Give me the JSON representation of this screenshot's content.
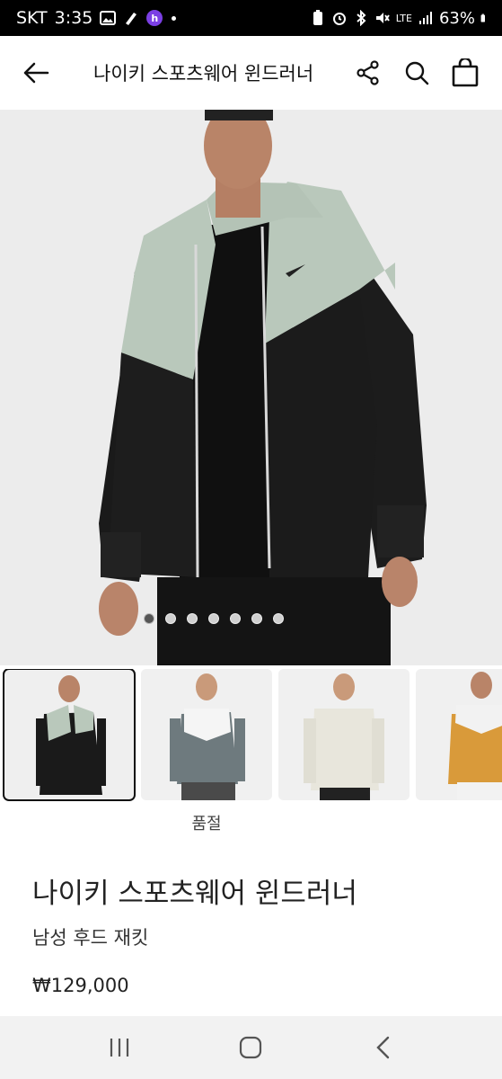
{
  "status_bar": {
    "carrier": "SKT",
    "time": "3:35",
    "network": "LTE",
    "battery": "63%"
  },
  "header": {
    "title": "나이키 스포츠웨어 윈드러너"
  },
  "hero": {
    "carousel_total": 7,
    "carousel_active": 1
  },
  "thumbnails": {
    "selected_index": 0,
    "label": "품절"
  },
  "product": {
    "title": "나이키 스포츠웨어 윈드러너",
    "subtitle": "남성 후드 재킷",
    "price": "₩129,000"
  },
  "colors": {
    "jacket_light": "#b9c8bb",
    "jacket_dark": "#1a1a1a",
    "background": "#eaeaea"
  }
}
